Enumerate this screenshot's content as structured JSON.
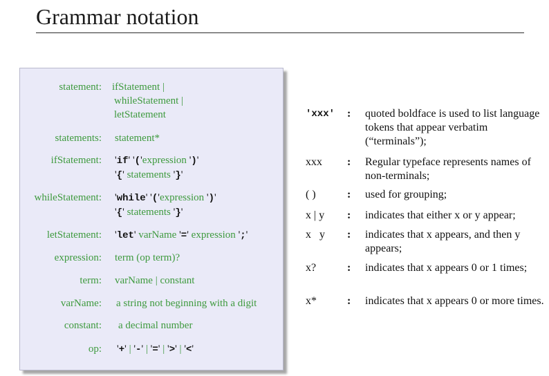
{
  "title": "Grammar notation",
  "grammar": {
    "statement": {
      "label": "statement:",
      "lines": [
        "ifStatement |",
        "whileStatement |",
        "letStatement"
      ]
    },
    "statements": {
      "label": "statements:",
      "def": "statement*"
    },
    "ifStatement": {
      "label": "ifStatement:",
      "kw": "if",
      "lparen": "(",
      "expr": "expression",
      "rparen": ")",
      "lbrace": "{",
      "stmts": "statements",
      "rbrace": "}"
    },
    "whileStatement": {
      "label": "whileStatement:",
      "kw": "while",
      "lparen": "(",
      "expr": "expression",
      "rparen": ")",
      "lbrace": "{",
      "stmts": "statements",
      "rbrace": "}"
    },
    "letStatement": {
      "label": "letStatement:",
      "kw": "let",
      "var": "varName",
      "eq": "=",
      "expr": "expression",
      "semi": ";"
    },
    "expression": {
      "label": "expression:",
      "def": "term (op term)?"
    },
    "term": {
      "label": "term:",
      "def": "varName | constant"
    },
    "varName": {
      "label": "varName:",
      "def": "a string not beginning  with a digit"
    },
    "constant": {
      "label": "constant:",
      "def": "a decimal number"
    },
    "op": {
      "label": "op:",
      "plus": "+",
      "minus": "-",
      "eq": "=",
      "gt": ">",
      "lt": "<"
    }
  },
  "legend": [
    {
      "symbol": "'xxx'",
      "colon": ":",
      "desc": "quoted boldface is used to list language tokens that appear verbatim (“terminals”);"
    },
    {
      "symbol": "xxx",
      "colon": ":",
      "desc": "Regular typeface represents names of non-terminals;"
    },
    {
      "symbol": "( )",
      "colon": ":",
      "desc": "used for grouping;"
    },
    {
      "symbol": "x | y",
      "colon": ":",
      "desc": "indicates that either x or y appear;"
    },
    {
      "symbol": "x   y",
      "colon": ":",
      "desc": "indicates that x appears, and then y appears;"
    },
    {
      "symbol": "x?",
      "colon": ":",
      "desc": "indicates that x appears 0 or 1 times;"
    },
    {
      "symbol": "x*",
      "colon": ":",
      "desc": "indicates that x appears 0 or more times."
    }
  ]
}
